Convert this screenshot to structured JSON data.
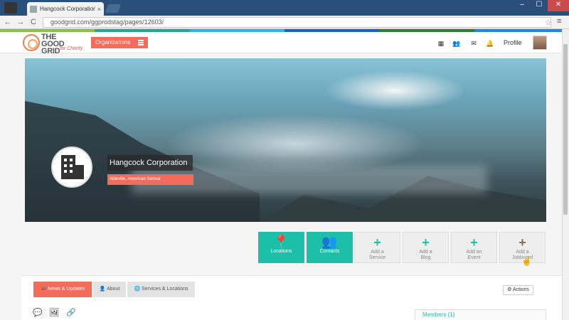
{
  "browser": {
    "tab_title": "Hangcock Corporation - T",
    "close_glyph": "×",
    "url": "goodgrid.com/ggprodstag/pages/12603/",
    "nav": {
      "back": "←",
      "forward": "→",
      "reload": "C"
    },
    "star_glyph": "☆",
    "menu_glyph": "≡",
    "window": {
      "minimize": "–",
      "maximize": "☐",
      "close": "✕"
    }
  },
  "header": {
    "logo_word": "THE GOOD GRID",
    "logo_tagline": "for Charity",
    "org_dropdown_label": "Organizations",
    "icons": [
      "apps-icon",
      "people-icon",
      "mail-icon",
      "bell-icon"
    ],
    "icon_glyphs": [
      "▦",
      "👥",
      "✉",
      "🔔"
    ],
    "profile_label": "Profile"
  },
  "colors": {
    "accent": "#f26b5b",
    "teal": "#1ebfa8",
    "strip": [
      "#8bc34a",
      "#26a69a",
      "#29b6f6",
      "#1565c0",
      "#2e7d32",
      "#1e88e5"
    ]
  },
  "hero": {
    "org_name": "Hangcock Corporation",
    "org_location": "Aldeville, American Samoa"
  },
  "actions": [
    {
      "label_1": "Locations",
      "label_2": "",
      "icon": "📍",
      "style": "teal"
    },
    {
      "label_1": "Contacts",
      "label_2": "",
      "icon": "👥",
      "style": "teal"
    },
    {
      "label_1": "Add a",
      "label_2": "Service",
      "icon": "+",
      "style": "grey"
    },
    {
      "label_1": "Add a",
      "label_2": "Blog",
      "icon": "+",
      "style": "grey"
    },
    {
      "label_1": "Add an",
      "label_2": "Event",
      "icon": "+",
      "style": "grey"
    },
    {
      "label_1": "Add a",
      "label_2": "Jobboard",
      "icon": "+",
      "style": "brown"
    }
  ],
  "content": {
    "tabs": [
      "News & Updates",
      "About",
      "Services & Locations"
    ],
    "tab_icons": [
      "📣",
      "👤",
      "🌐"
    ],
    "actions_label": "Actions",
    "actions_icon": "⚙",
    "mini_icons": [
      "💬",
      "🖼",
      "🔗"
    ],
    "members_label": "Members (1)"
  }
}
